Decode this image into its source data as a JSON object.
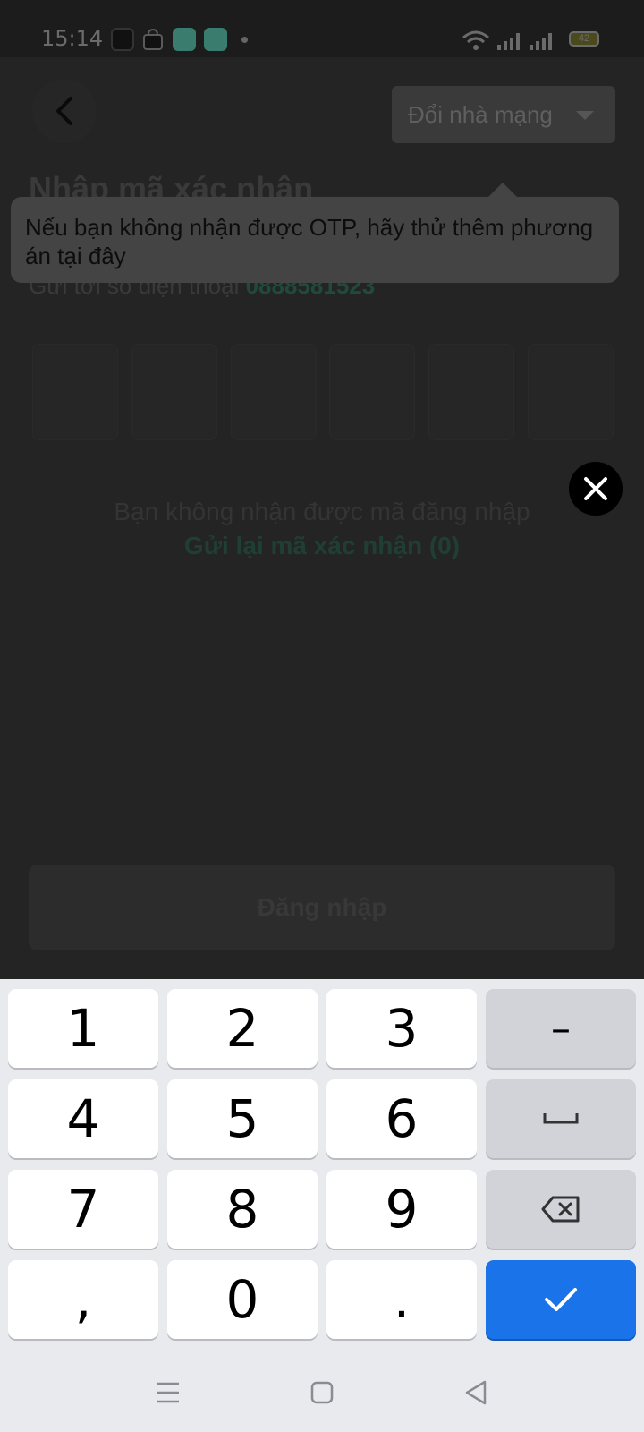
{
  "status_bar": {
    "time": "15:14",
    "battery": "42",
    "app_icons": [
      "news-icon",
      "shopping-bag-icon",
      "calendar-app-icon",
      "files-app-icon"
    ]
  },
  "header": {
    "back_icon": "back-arrow-icon",
    "carrier_button_label": "Đổi nhà mạng"
  },
  "main": {
    "title": "Nhập mã xác nhận",
    "sent_to_text": "Gửi tới số điện thoại",
    "phone_number": "0888581523",
    "otp_length": 6,
    "resend_hint": "Bạn không nhận được mã đăng nhập",
    "resend_link": "Gửi lại mã xác nhận (0)",
    "login_button": "Đăng nhập"
  },
  "tooltip": {
    "text": "Nếu bạn không nhận được OTP, hãy thử thêm phương án tại đây"
  },
  "overlay": {
    "close_icon": "close-icon"
  },
  "keyboard": {
    "rows": [
      [
        "1",
        "2",
        "3",
        "–"
      ],
      [
        "4",
        "5",
        "6",
        "space"
      ],
      [
        "7",
        "8",
        "9",
        "backspace"
      ],
      [
        ",",
        "0",
        ".",
        "enter"
      ]
    ],
    "labels": {
      "k1": "1",
      "k2": "2",
      "k3": "3",
      "dash": "–",
      "k4": "4",
      "k5": "5",
      "k6": "6",
      "k7": "7",
      "k8": "8",
      "k9": "9",
      "comma": ",",
      "k0": "0",
      "dot": "."
    },
    "accent_color": "#1a73e8"
  },
  "nav_bar": {
    "items": [
      "menu-icon",
      "home-icon",
      "back-icon"
    ]
  }
}
